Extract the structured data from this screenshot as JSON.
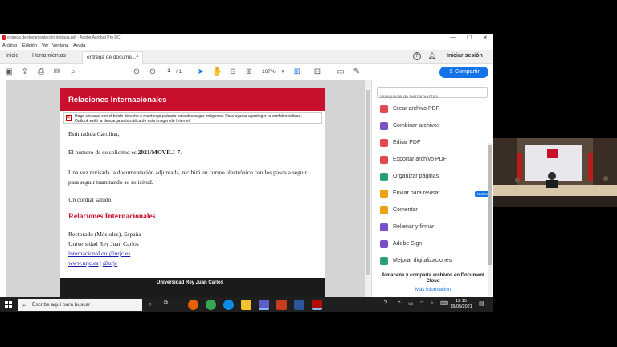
{
  "window": {
    "title": "entrega de documentación iniciada.pdf - Adobe Acrobat Pro DC",
    "controls": {
      "minimize": "—",
      "maximize": "☐",
      "close": "✕"
    }
  },
  "menu": [
    "Archivo",
    "Edición",
    "Ver",
    "Ventana",
    "Ayuda"
  ],
  "tabs": {
    "home": "Inicio",
    "tools": "Herramientas",
    "document": "entrega de docume...",
    "document_close": "×",
    "help": "?",
    "signin": "Iniciar sesión"
  },
  "toolbar": {
    "page_current": "1",
    "page_total": "/ 1",
    "zoom": "107%",
    "share_label": "Compartir"
  },
  "document": {
    "banner_title": "Relaciones Internacionales",
    "image_notice": "Haga clic aquí con el botón derecho o mantenga pulsado para descargar imágenes. Para ayudar a proteger la confidencialidad, Outlook evitó la descarga automática de esta imagen de Internet.",
    "greeting": "Estimado/a Carolina,",
    "request_text": "El número de su solicitud es ",
    "request_number": "2021/MOVILI-7",
    "request_end": ".",
    "paragraph": "Una vez revisada la documentación adjuntada, recibirá un correo electrónico con los pasos a seguir para seguir tramitando su solicitud.",
    "closing": "Un cordial saludo.",
    "signature_heading": "Relaciones Internacionales",
    "address_line1": "Rectorado (Móstoles), España",
    "address_line2": "Universidad Rey Juan Carlos",
    "email": "internacional.out@urjc.es",
    "website": "www.urjc.es",
    "separator": " | ",
    "twitter": "@urjc",
    "footer": "Universidad Rey Juan Carlos"
  },
  "tools_pane": {
    "search_placeholder": "Búsqueda de herramientas",
    "items": [
      {
        "label": "Crear archivo PDF",
        "color": "#e34850"
      },
      {
        "label": "Combinar archivos",
        "color": "#7b4fc9"
      },
      {
        "label": "Editar PDF",
        "color": "#e34850"
      },
      {
        "label": "Exportar archivo PDF",
        "color": "#e34850"
      },
      {
        "label": "Organizar páginas",
        "color": "#2d9d78"
      },
      {
        "label": "Enviar para revisar",
        "color": "#e8a317",
        "badge": "NUEVA"
      },
      {
        "label": "Comentar",
        "color": "#e8a317"
      },
      {
        "label": "Rellenar y firmar",
        "color": "#7b4fc9"
      },
      {
        "label": "Adobe Sign",
        "color": "#7b4fc9"
      },
      {
        "label": "Mejorar digitalizaciones",
        "color": "#2d9d78"
      }
    ],
    "cloud_text": "Almacene y comparta archivos en Document Cloud",
    "cloud_link": "Más información"
  },
  "taskbar": {
    "search_placeholder": "Escribe aquí para buscar",
    "time": "12:15",
    "date": "18/05/2021"
  }
}
